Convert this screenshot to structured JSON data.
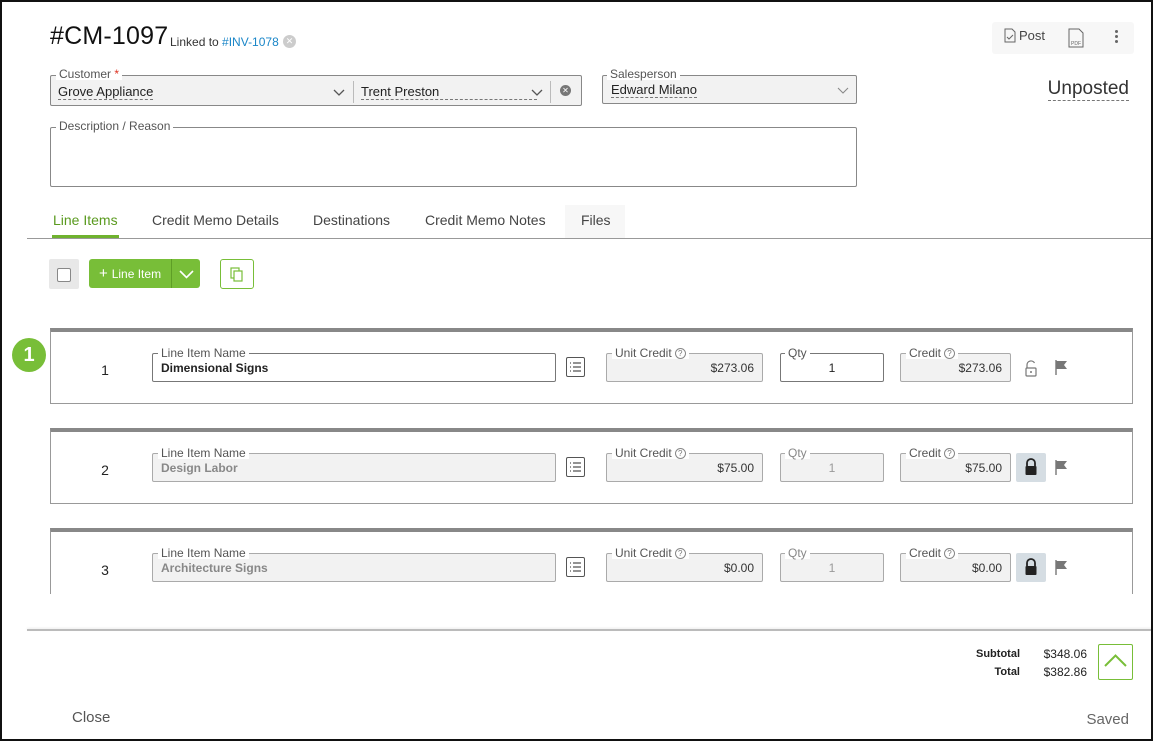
{
  "header": {
    "title": "#CM-1097",
    "linked_prefix": "Linked to",
    "linked_ref": "#INV-1078",
    "post_label": "Post",
    "status": "Unposted"
  },
  "form": {
    "customer": {
      "label": "Customer",
      "required_mark": "*",
      "value": "Grove Appliance",
      "contact": "Trent Preston"
    },
    "salesperson": {
      "label": "Salesperson",
      "value": "Edward Milano"
    },
    "description": {
      "label": "Description / Reason",
      "value": ""
    }
  },
  "tabs": [
    "Line Items",
    "Credit Memo Details",
    "Destinations",
    "Credit Memo Notes",
    "Files"
  ],
  "toolbar": {
    "add_label": "Line Item"
  },
  "line_items": [
    {
      "num": "1",
      "name_label": "Line Item Name",
      "name": "Dimensional Signs",
      "unit_credit_label": "Unit Credit",
      "unit_credit": "$273.06",
      "qty_label": "Qty",
      "qty": "1",
      "credit_label": "Credit",
      "credit": "$273.06",
      "locked": false,
      "editable": true
    },
    {
      "num": "2",
      "name_label": "Line Item Name",
      "name": "Design Labor",
      "unit_credit_label": "Unit Credit",
      "unit_credit": "$75.00",
      "qty_label": "Qty",
      "qty": "1",
      "credit_label": "Credit",
      "credit": "$75.00",
      "locked": true,
      "editable": false
    },
    {
      "num": "3",
      "name_label": "Line Item Name",
      "name": "Architecture Signs",
      "unit_credit_label": "Unit Credit",
      "unit_credit": "$0.00",
      "qty_label": "Qty",
      "qty": "1",
      "credit_label": "Credit",
      "credit": "$0.00",
      "locked": true,
      "editable": false
    }
  ],
  "help_glyph": "?",
  "badge": "1",
  "totals": {
    "subtotal_label": "Subtotal",
    "subtotal": "$348.06",
    "total_label": "Total",
    "total": "$382.86"
  },
  "footer": {
    "close_label": "Close",
    "saved_label": "Saved"
  },
  "colors": {
    "accent": "#78be38",
    "link": "#1a86c8",
    "tab_active": "#5a9a1f"
  }
}
